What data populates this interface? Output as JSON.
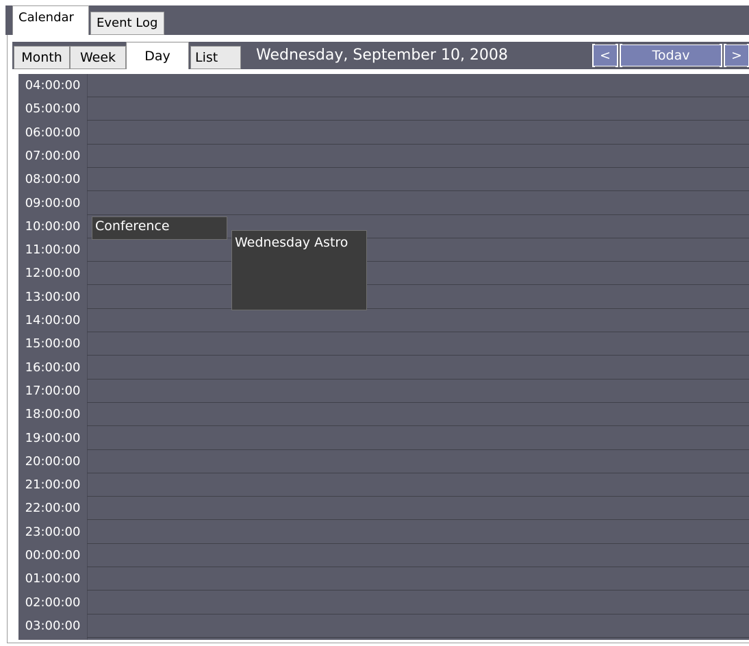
{
  "outer_tabs": [
    "Calendar",
    "Event Log"
  ],
  "view_tabs": [
    "Month",
    "Week",
    "Day",
    "List"
  ],
  "active_view": "Day",
  "date_title": "Wednesday, September 10, 2008",
  "nav": {
    "prev": "<",
    "today": "Todav",
    "next": ">"
  },
  "hours": [
    "04:00:00",
    "05:00:00",
    "06:00:00",
    "07:00:00",
    "08:00:00",
    "09:00:00",
    "10:00:00",
    "11:00:00",
    "12:00:00",
    "13:00:00",
    "14:00:00",
    "15:00:00",
    "16:00:00",
    "17:00:00",
    "18:00:00",
    "19:00:00",
    "20:00:00",
    "21:00:00",
    "22:00:00",
    "23:00:00",
    "00:00:00",
    "01:00:00",
    "02:00:00",
    "03:00:00"
  ],
  "events": [
    {
      "title": "Conference"
    },
    {
      "title": "Wednesday Astro"
    }
  ],
  "colors": {
    "grid_bg": "#5a5b69",
    "event_bg": "#3c3c3c",
    "nav_btn": "#7880b2"
  }
}
